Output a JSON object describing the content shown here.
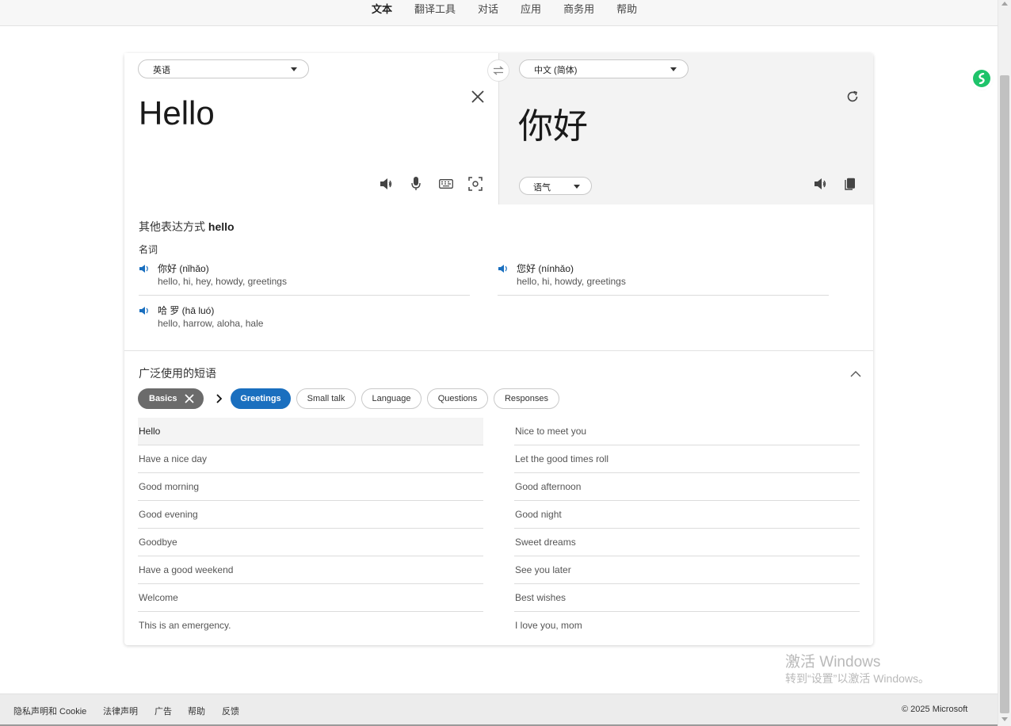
{
  "topnav": {
    "items": [
      "文本",
      "翻译工具",
      "对话",
      "应用",
      "商务用",
      "帮助"
    ]
  },
  "translator": {
    "source_lang": "英语",
    "target_lang": "中文 (简体)",
    "source_text": "Hello",
    "target_text": "你好",
    "tone_label": "语气"
  },
  "alternatives": {
    "title_prefix": "其他表达方式",
    "title_word": "hello",
    "pos": "名词",
    "items": [
      {
        "word": "你好 (nǐhǎo)",
        "synonyms": "hello, hi, hey, howdy, greetings"
      },
      {
        "word": "您好 (nínhǎo)",
        "synonyms": "hello, hi, howdy, greetings"
      },
      {
        "word": "哈 罗 (hā luó)",
        "synonyms": "hello, harrow, aloha, hale"
      }
    ]
  },
  "phrases": {
    "title": "广泛使用的短语",
    "chips": {
      "basics": "Basics",
      "greetings": "Greetings",
      "small_talk": "Small talk",
      "language": "Language",
      "questions": "Questions",
      "responses": "Responses"
    },
    "left": [
      "Hello",
      "Have a nice day",
      "Good morning",
      "Good evening",
      "Goodbye",
      "Have a good weekend",
      "Welcome",
      "This is an emergency."
    ],
    "right": [
      "Nice to meet you",
      "Let the good times roll",
      "Good afternoon",
      "Good night",
      "Sweet dreams",
      "See you later",
      "Best wishes",
      "I love you, mom"
    ]
  },
  "watermark": {
    "line1": "激活 Windows",
    "line2": "转到“设置”以激活 Windows。"
  },
  "footer": {
    "links": [
      "隐私声明和 Cookie",
      "法律声明",
      "广告",
      "帮助",
      "反馈"
    ],
    "copyright": "© 2025 Microsoft"
  },
  "colors": {
    "accent": "#1a6fbf",
    "chip_dark": "#6b6b6b",
    "extension": "#1ec36a"
  }
}
